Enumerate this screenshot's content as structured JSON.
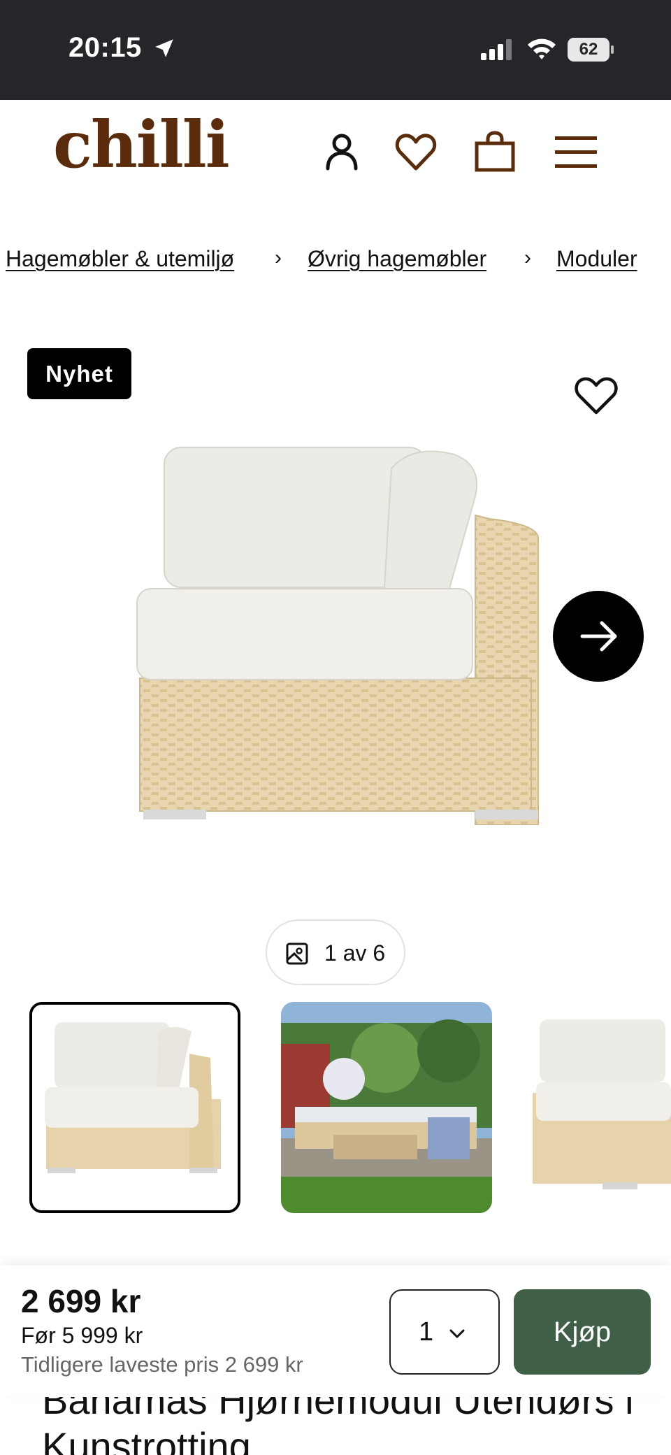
{
  "status_bar": {
    "time": "20:15",
    "battery": "62"
  },
  "header": {
    "logo": "chilli",
    "icons": [
      "account-icon",
      "heart-icon",
      "bag-icon",
      "menu-icon"
    ]
  },
  "breadcrumb": {
    "items": [
      "Hagemøbler & utemiljø",
      "Øvrig hagemøbler",
      "Moduler"
    ],
    "separator": "›"
  },
  "product": {
    "badge": "Nyhet",
    "image_counter": "1 av 6",
    "title": "Bahamas Hjørnemodul Utendørs i Kunstrotting"
  },
  "buy_bar": {
    "price": "2 699 kr",
    "before_price": "Før 5 999 kr",
    "lowest_price": "Tidligere laveste pris 2 699 kr",
    "quantity": "1",
    "buy_label": "Kjøp"
  },
  "colors": {
    "brand": "#5b2c0b",
    "buy_button": "#3f5f47",
    "status_bar": "#26262a"
  }
}
